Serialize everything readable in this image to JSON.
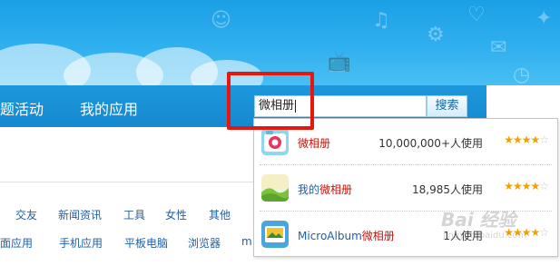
{
  "nav": {
    "items": [
      "题活动",
      "我的应用"
    ]
  },
  "search": {
    "value": "微相册",
    "button_label": "搜索"
  },
  "categories": {
    "row1": [
      "交友",
      "新闻资讯",
      "工具",
      "女性",
      "其他"
    ],
    "row2": [
      "桌面应用",
      "手机应用",
      "平板电脑",
      "浏览器",
      "m"
    ]
  },
  "suggestions": [
    {
      "name_prefix": "",
      "name_highlight": "微相册",
      "users": "10,000,000+人使用",
      "rating": 4,
      "icon": "camera-app-icon"
    },
    {
      "name_prefix": "我的",
      "name_highlight": "微相册",
      "users": "18,985人使用",
      "rating": 4,
      "icon": "landscape-photo-app-icon"
    },
    {
      "name_prefix": "MicroAlbum",
      "name_highlight": "微相册",
      "users": "1人使用",
      "rating": 4,
      "icon": "photo-album-app-icon"
    }
  ],
  "watermark": {
    "brand": "Bai 经验",
    "url": "jingyan.baidu.com"
  },
  "colors": {
    "sky": "#2fb0ef",
    "navbar": "#1689cf",
    "highlight_box": "#e8160c",
    "link": "#1f5fa8",
    "match_highlight": "#c0140c",
    "star": "#f2a000"
  }
}
